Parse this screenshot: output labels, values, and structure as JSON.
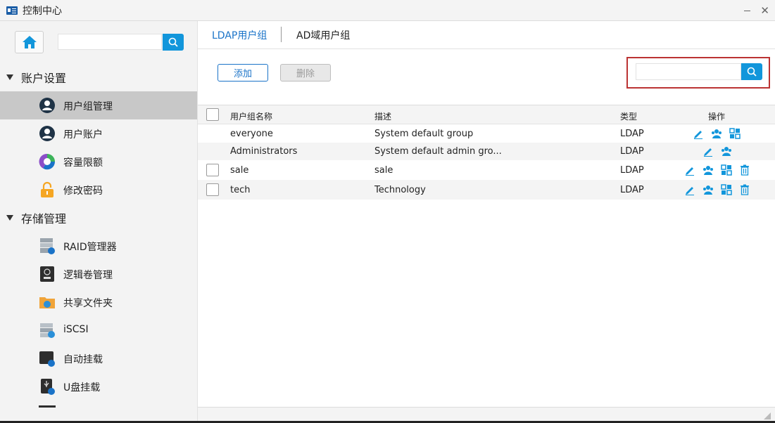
{
  "window": {
    "title": "控制中心"
  },
  "sidebar": {
    "sections": [
      {
        "label": "账户设置",
        "items": [
          {
            "label": "用户组管理",
            "icon": "user-group-icon",
            "active": true
          },
          {
            "label": "用户账户",
            "icon": "user-account-icon"
          },
          {
            "label": "容量限额",
            "icon": "quota-icon"
          },
          {
            "label": "修改密码",
            "icon": "lock-icon"
          }
        ]
      },
      {
        "label": "存储管理",
        "items": [
          {
            "label": "RAID管理器",
            "icon": "raid-icon"
          },
          {
            "label": "逻辑卷管理",
            "icon": "lvm-icon"
          },
          {
            "label": "共享文件夹",
            "icon": "shared-folder-icon"
          },
          {
            "label": "iSCSI",
            "icon": "iscsi-icon"
          },
          {
            "label": "自动挂载",
            "icon": "automount-icon"
          },
          {
            "label": "U盘挂载",
            "icon": "usb-mount-icon"
          }
        ]
      }
    ]
  },
  "tabs": [
    {
      "label": "LDAP用户组",
      "active": true
    },
    {
      "label": "AD域用户组",
      "active": false
    }
  ],
  "toolbar": {
    "add_label": "添加",
    "delete_label": "删除"
  },
  "table": {
    "headers": {
      "name": "用户组名称",
      "desc": "描述",
      "type": "类型",
      "ops": "操作"
    },
    "rows": [
      {
        "name": "everyone",
        "desc": "System default group",
        "type": "LDAP",
        "checkbox": false,
        "ops": [
          "edit",
          "members",
          "permissions"
        ]
      },
      {
        "name": "Administrators",
        "desc": "System default admin gro...",
        "type": "LDAP",
        "checkbox": false,
        "ops": [
          "edit",
          "members"
        ]
      },
      {
        "name": "sale",
        "desc": "sale",
        "type": "LDAP",
        "checkbox": true,
        "ops": [
          "edit",
          "members",
          "permissions",
          "delete"
        ]
      },
      {
        "name": "tech",
        "desc": "Technology",
        "type": "LDAP",
        "checkbox": true,
        "ops": [
          "edit",
          "members",
          "permissions",
          "delete"
        ]
      }
    ]
  },
  "colors": {
    "accent": "#1296db",
    "link": "#1a73c8",
    "active_item": "#c8c8c8",
    "highlight_box": "#b33333"
  }
}
